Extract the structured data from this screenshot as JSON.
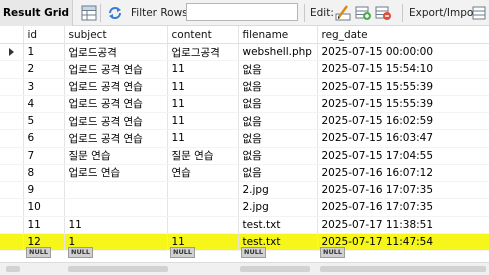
{
  "toolbar": {
    "tab_label": "Result Grid",
    "filter_label": "Filter Rows:",
    "filter_value": "",
    "edit_label": "Edit:",
    "export_label": "Export/Import:"
  },
  "grid": {
    "columns": [
      "id",
      "subject",
      "content",
      "filename",
      "reg_date"
    ],
    "rows": [
      [
        "1",
        "업로드공격",
        "업로그공격",
        "webshell.php",
        "2025-07-15 00:00:00"
      ],
      [
        "2",
        "업로드 공격 연습",
        "11",
        "없음",
        "2025-07-15 15:54:10"
      ],
      [
        "3",
        "업로드 공격 연습",
        "11",
        "없음",
        "2025-07-15 15:55:39"
      ],
      [
        "4",
        "업로드 공격 연습",
        "11",
        "없음",
        "2025-07-15 15:55:39"
      ],
      [
        "5",
        "업로드 공격 연습",
        "11",
        "없음",
        "2025-07-15 16:02:59"
      ],
      [
        "6",
        "업로드 공격 연습",
        "11",
        "없음",
        "2025-07-15 16:03:47"
      ],
      [
        "7",
        "질문 연습",
        "질문 연습",
        "없음",
        "2025-07-15 17:04:55"
      ],
      [
        "8",
        "업로드 연습",
        "연습",
        "없음",
        "2025-07-16 16:07:12"
      ],
      [
        "9",
        "",
        "",
        "2.jpg",
        "2025-07-16 17:07:35"
      ],
      [
        "10",
        "",
        "",
        "2.jpg",
        "2025-07-16 17:07:35"
      ],
      [
        "11",
        "11",
        "",
        "test.txt",
        "2025-07-17 11:38:51"
      ],
      [
        "12",
        "1",
        "11",
        "test.txt",
        "2025-07-17 11:47:54"
      ]
    ],
    "highlight_color": "#f6f61a",
    "null_label": "NULL"
  }
}
